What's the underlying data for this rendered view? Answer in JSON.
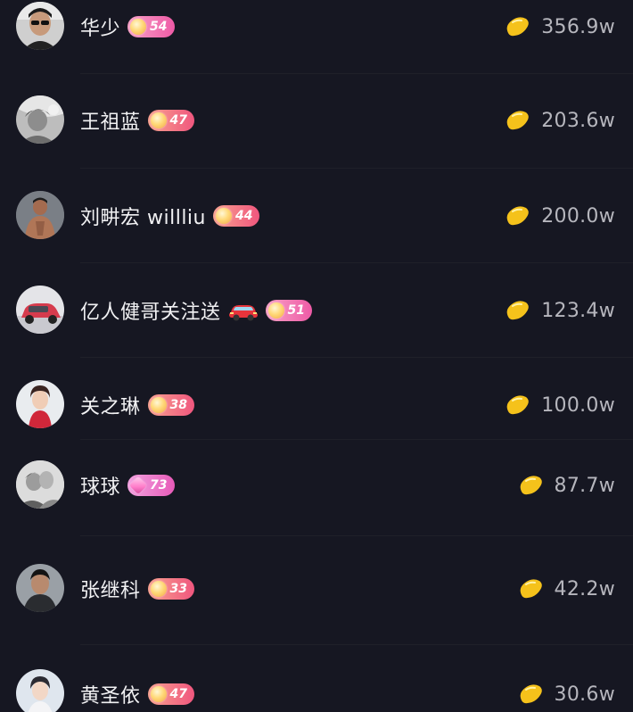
{
  "colors": {
    "background": "#161722",
    "name_text": "#f1f1f3",
    "amount_text": "#b6b6bd",
    "bean": "#f5c21b"
  },
  "entries": [
    {
      "name": "华少",
      "level": "54",
      "amount": "356.9w",
      "badge_color": "#ee5aa6",
      "badge_icon": "coin",
      "avatar": "man-glasses"
    },
    {
      "name": "王祖蓝",
      "level": "47",
      "amount": "203.6w",
      "badge_color": "#f0567e",
      "badge_icon": "coin",
      "avatar": "person-bw"
    },
    {
      "name": "刘畊宏 willliu",
      "level": "44",
      "amount": "200.0w",
      "badge_color": "#f0567e",
      "badge_icon": "coin",
      "avatar": "man-shirtless"
    },
    {
      "name": "亿人健哥关注送",
      "level": "51",
      "amount": "123.4w",
      "badge_color": "#ee5aa6",
      "badge_icon": "coin",
      "trailing_icon": "car-icon",
      "avatar": "red-car"
    },
    {
      "name": "关之琳",
      "level": "38",
      "amount": "100.0w",
      "badge_color": "#f0567e",
      "badge_icon": "coin",
      "avatar": "woman-red"
    },
    {
      "name": "球球",
      "level": "73",
      "amount": "87.7w",
      "badge_color": "#e75ab8",
      "badge_icon": "gem",
      "avatar": "couple-bw"
    },
    {
      "name": "张继科",
      "level": "33",
      "amount": "42.2w",
      "badge_color": "#f0567e",
      "badge_icon": "coin",
      "avatar": "man-dark"
    },
    {
      "name": "黄圣依",
      "level": "47",
      "amount": "30.6w",
      "badge_color": "#f0567e",
      "badge_icon": "coin",
      "avatar": "woman-light"
    }
  ]
}
